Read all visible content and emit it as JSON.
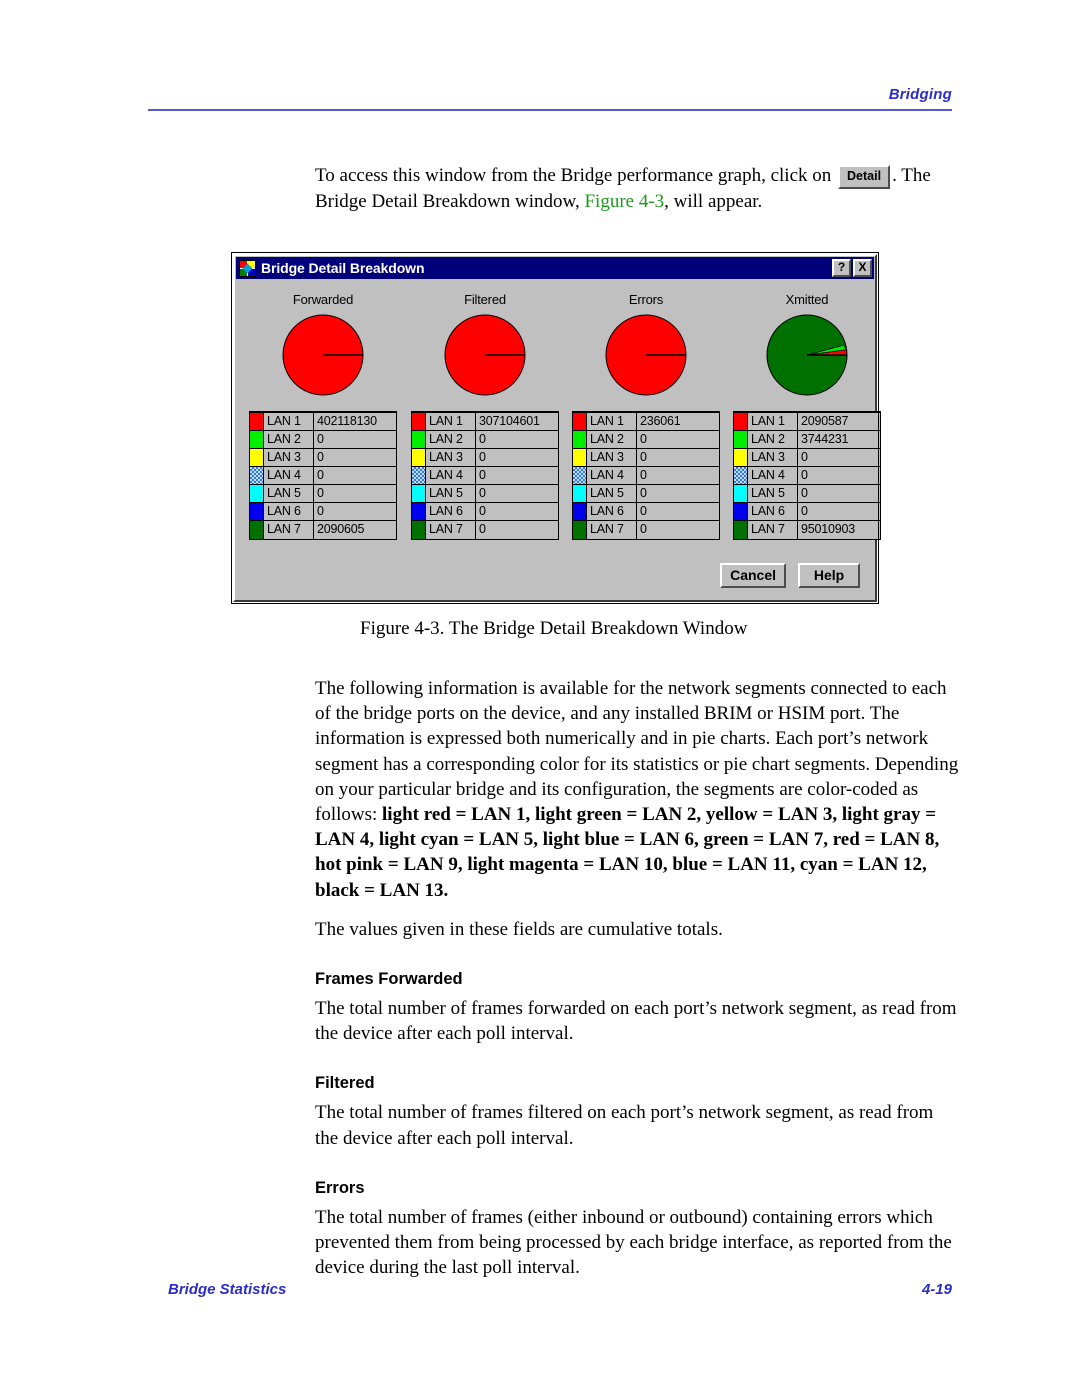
{
  "header": {
    "section_title": "Bridging"
  },
  "footer": {
    "left": "Bridge Statistics",
    "page_number": "4-19"
  },
  "intro": {
    "line1_before": "To access this window from the Bridge performance graph, click on",
    "detail_button": "Detail",
    "line1_after": ". The",
    "line2_before": "Bridge Detail Breakdown window,",
    "xref": "Figure 4-3",
    "line2_after": ", will appear."
  },
  "figure_caption": "Figure 4-3.  The Bridge Detail Breakdown Window",
  "dialog": {
    "title": "Bridge Detail Breakdown",
    "help_button": "?",
    "close_button": "X",
    "cancel_button": "Cancel",
    "ok_help_button": "Help",
    "lan_labels": [
      "LAN 1",
      "LAN 2",
      "LAN 3",
      "LAN 4",
      "LAN 5",
      "LAN 6",
      "LAN 7"
    ],
    "swatch_colors": {
      "lan1": "#ff0000",
      "lan2": "#00ee00",
      "lan3": "#ffff00",
      "lan4": "#2a7fe0",
      "lan5": "#00ffff",
      "lan6": "#0000ee",
      "lan7": "#007000"
    },
    "columns": [
      {
        "title": "Forwarded",
        "values": [
          "402118130",
          "0",
          "0",
          "0",
          "0",
          "0",
          "2090605"
        ]
      },
      {
        "title": "Filtered",
        "values": [
          "307104601",
          "0",
          "0",
          "0",
          "0",
          "0",
          "0"
        ]
      },
      {
        "title": "Errors",
        "values": [
          "236061",
          "0",
          "0",
          "0",
          "0",
          "0",
          "0"
        ]
      },
      {
        "title": "Xmitted",
        "values": [
          "2090587",
          "3744231",
          "0",
          "0",
          "0",
          "0",
          "95010903"
        ]
      }
    ]
  },
  "chart_data": [
    {
      "type": "pie",
      "title": "Forwarded",
      "categories": [
        "LAN 1",
        "LAN 2",
        "LAN 3",
        "LAN 4",
        "LAN 5",
        "LAN 6",
        "LAN 7"
      ],
      "values": [
        402118130,
        0,
        0,
        0,
        0,
        0,
        2090605
      ],
      "colors": [
        "#ff0000",
        "#00ee00",
        "#ffff00",
        "#2a7fe0",
        "#00ffff",
        "#0000ee",
        "#007000"
      ]
    },
    {
      "type": "pie",
      "title": "Filtered",
      "categories": [
        "LAN 1",
        "LAN 2",
        "LAN 3",
        "LAN 4",
        "LAN 5",
        "LAN 6",
        "LAN 7"
      ],
      "values": [
        307104601,
        0,
        0,
        0,
        0,
        0,
        0
      ],
      "colors": [
        "#ff0000",
        "#00ee00",
        "#ffff00",
        "#2a7fe0",
        "#00ffff",
        "#0000ee",
        "#007000"
      ]
    },
    {
      "type": "pie",
      "title": "Errors",
      "categories": [
        "LAN 1",
        "LAN 2",
        "LAN 3",
        "LAN 4",
        "LAN 5",
        "LAN 6",
        "LAN 7"
      ],
      "values": [
        236061,
        0,
        0,
        0,
        0,
        0,
        0
      ],
      "colors": [
        "#ff0000",
        "#00ee00",
        "#ffff00",
        "#2a7fe0",
        "#00ffff",
        "#0000ee",
        "#007000"
      ]
    },
    {
      "type": "pie",
      "title": "Xmitted",
      "categories": [
        "LAN 1",
        "LAN 2",
        "LAN 3",
        "LAN 4",
        "LAN 5",
        "LAN 6",
        "LAN 7"
      ],
      "values": [
        2090587,
        3744231,
        0,
        0,
        0,
        0,
        95010903
      ],
      "colors": [
        "#ff0000",
        "#00ee00",
        "#ffff00",
        "#2a7fe0",
        "#00ffff",
        "#0000ee",
        "#007000"
      ]
    }
  ],
  "body": {
    "para1": "The following information is available for the network segments connected to each of the bridge ports on the device, and any installed BRIM or HSIM port. The information is expressed both numerically and in pie charts. Each port’s network segment has a corresponding color for its statistics or pie chart segments. Depending on your particular bridge and its configuration, the segments are color-coded as follows: ",
    "para1_bold": "light red = LAN 1, light green = LAN 2, yellow = LAN 3, light gray = LAN 4, light cyan = LAN 5, light blue = LAN 6, green = LAN 7, red = LAN 8, hot pink = LAN 9, light magenta = LAN 10, blue = LAN 11, cyan = LAN 12, black = LAN 13.",
    "para2": "The values given in these fields are cumulative totals.",
    "heading_forwarded": "Frames Forwarded",
    "para_forwarded": "The total number of frames forwarded on each port’s network segment, as read from the device after each poll interval.",
    "heading_filtered": "Filtered",
    "para_filtered": "The total number of frames filtered on each port’s network segment, as read from the device after each poll interval.",
    "heading_errors": "Errors",
    "para_errors": "The total number of frames (either inbound or outbound) containing errors which prevented them from being processed by each bridge interface, as reported from the device during the last poll interval."
  }
}
